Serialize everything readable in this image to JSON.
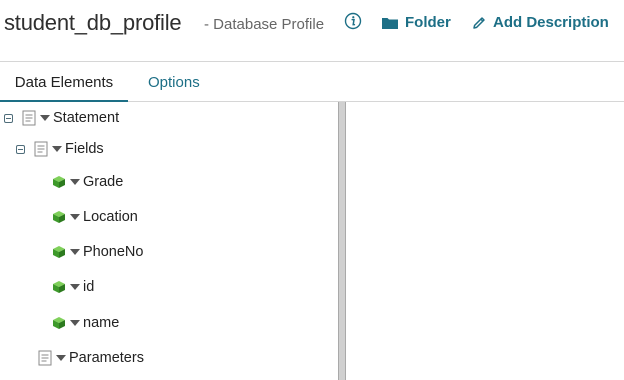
{
  "header": {
    "title": "student_db_profile",
    "subtitle": "- Database Profile",
    "actions": {
      "folder_label": "Folder",
      "add_description_label": "Add Description"
    }
  },
  "tabs": [
    {
      "label": "Data Elements",
      "active": true
    },
    {
      "label": "Options",
      "active": false
    }
  ],
  "tree": {
    "statement": {
      "label": "Statement"
    },
    "fields": {
      "label": "Fields"
    },
    "field_items": [
      {
        "label": "Grade"
      },
      {
        "label": "Location"
      },
      {
        "label": "PhoneNo"
      },
      {
        "label": "id"
      },
      {
        "label": "name"
      }
    ],
    "parameters": {
      "label": "Parameters"
    }
  },
  "colors": {
    "accent": "#1d6f86",
    "field_cube": "#3e9a2b"
  },
  "icons": [
    "info-icon",
    "folder-icon",
    "pencil-icon",
    "collapse-icon",
    "document-icon",
    "caret-down-icon",
    "cube-icon"
  ]
}
